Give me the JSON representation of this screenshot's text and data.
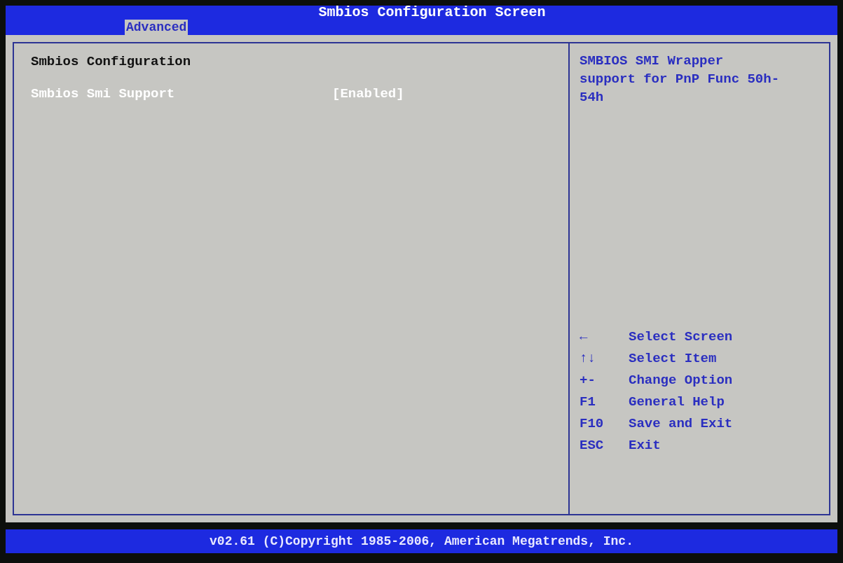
{
  "window": {
    "title": "Smbios Configuration Screen"
  },
  "tabs": [
    {
      "label": "Advanced",
      "selected": true
    }
  ],
  "main_panel": {
    "heading": "Smbios Configuration",
    "settings": [
      {
        "label": "Smbios Smi Support",
        "value": "[Enabled]",
        "selected": true
      }
    ]
  },
  "help_panel": {
    "description": "SMBIOS SMI Wrapper support for PnP Func 50h-54h",
    "keys": [
      {
        "key": "←",
        "action": "Select Screen"
      },
      {
        "key": "↑↓",
        "action": "Select Item"
      },
      {
        "key": "+-",
        "action": "Change Option"
      },
      {
        "key": "F1",
        "action": "General Help"
      },
      {
        "key": "F10",
        "action": "Save and Exit"
      },
      {
        "key": "ESC",
        "action": "Exit"
      }
    ]
  },
  "status_bar": {
    "text": "v02.61 (C)Copyright 1985-2006, American Megatrends, Inc."
  }
}
